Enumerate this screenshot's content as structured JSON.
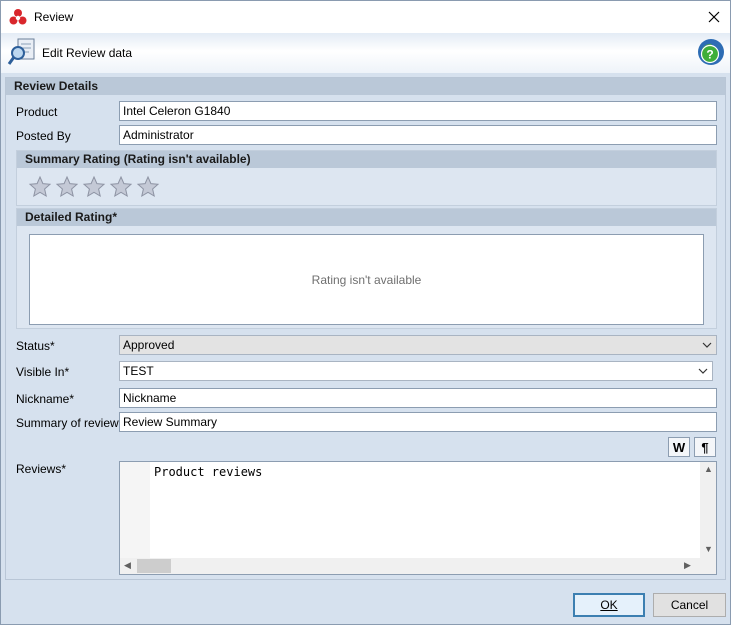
{
  "window": {
    "title": "Review"
  },
  "header": {
    "edit_label": "Edit Review data"
  },
  "review_details": {
    "section_title": "Review Details",
    "product_label": "Product",
    "product_value": "Intel Celeron G1840",
    "posted_by_label": "Posted By",
    "posted_by_value": "Administrator"
  },
  "summary_rating": {
    "title": "Summary Rating (Rating isn't available)",
    "stars_filled": 0,
    "stars_total": 5
  },
  "detailed_rating": {
    "title": "Detailed Rating*",
    "message": "Rating isn't available"
  },
  "form": {
    "status_label": "Status*",
    "status_value": "Approved",
    "visible_in_label": "Visible In*",
    "visible_in_value": "TEST",
    "nickname_label": "Nickname*",
    "nickname_value": "Nickname",
    "summary_label": "Summary of review*",
    "summary_value": "Review Summary",
    "reviews_label": "Reviews*",
    "reviews_value": "Product reviews"
  },
  "toolbar": {
    "word_wrap_glyph": "W",
    "pilcrow_glyph": "¶"
  },
  "footer": {
    "ok_label": "OK",
    "cancel_label": "Cancel"
  },
  "colors": {
    "accent": "#3c7fb1",
    "panel": "#d6e1ee",
    "group_header": "#bac8d8"
  }
}
